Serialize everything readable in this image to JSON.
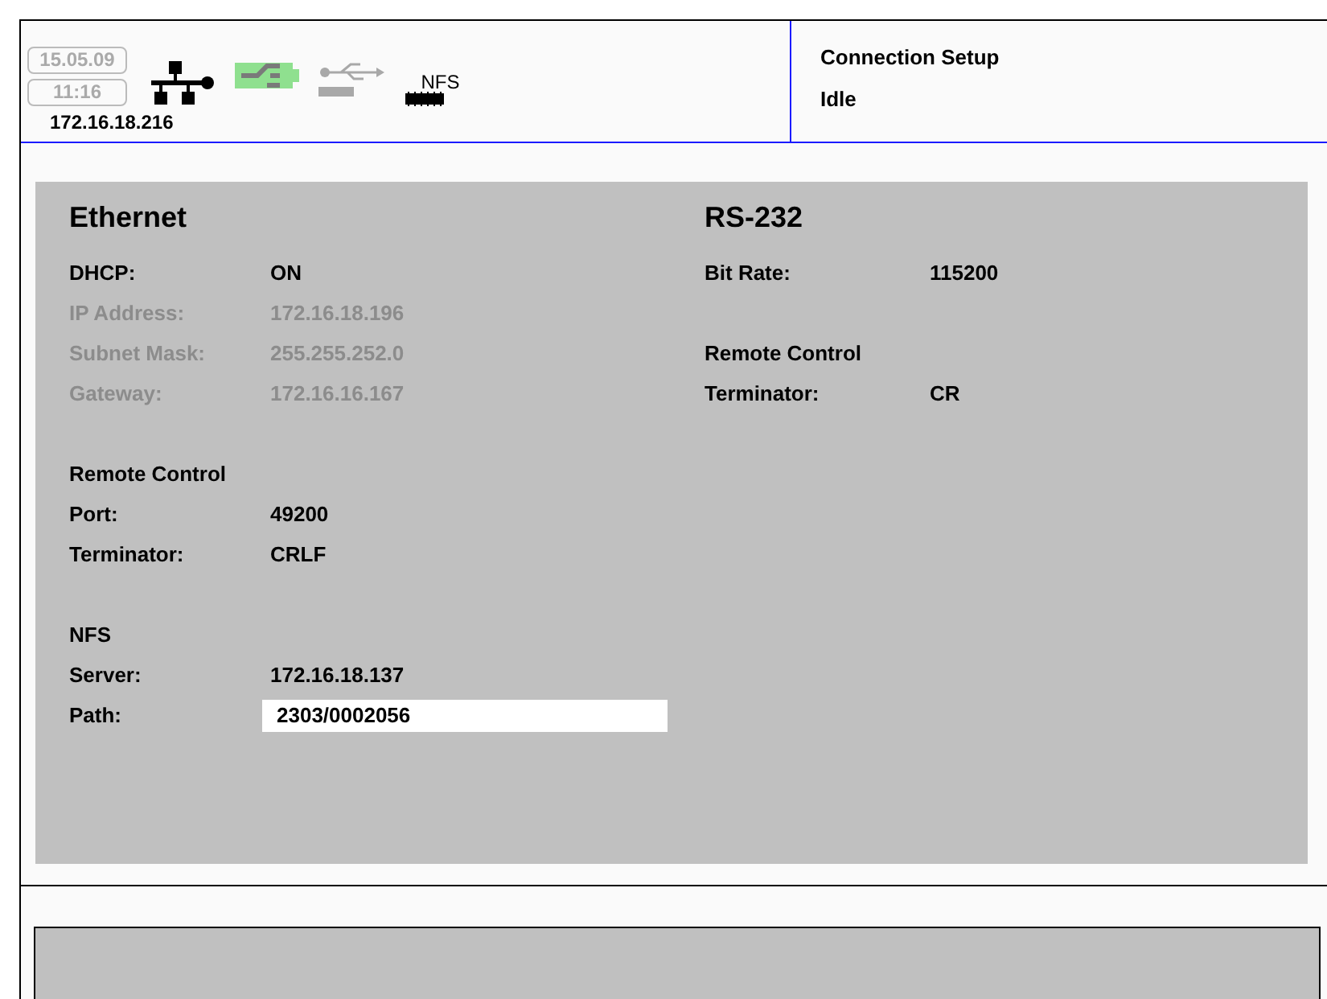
{
  "status": {
    "date": "15.05.09",
    "time": "11:16",
    "ip": "172.16.18.216",
    "nfs_label": "NFS"
  },
  "header": {
    "title": "Connection Setup",
    "state": "Idle"
  },
  "panels": [
    {
      "title": "Ethernet",
      "groups": [
        {
          "rows": [
            {
              "label": "DHCP:",
              "value": "ON",
              "disabled": false,
              "kind": "text"
            },
            {
              "label": "IP Address:",
              "value": "172.16.18.196",
              "disabled": true,
              "kind": "text"
            },
            {
              "label": "Subnet Mask:",
              "value": "255.255.252.0",
              "disabled": true,
              "kind": "text"
            },
            {
              "label": "Gateway:",
              "value": "172.16.16.167",
              "disabled": true,
              "kind": "text"
            }
          ]
        },
        {
          "heading": "Remote Control",
          "rows": [
            {
              "label": "Port:",
              "value": "49200",
              "disabled": false,
              "kind": "text"
            },
            {
              "label": "Terminator:",
              "value": "CRLF",
              "disabled": false,
              "kind": "text"
            }
          ]
        },
        {
          "heading": "NFS",
          "rows": [
            {
              "label": "Server:",
              "value": "172.16.18.137",
              "disabled": false,
              "kind": "text"
            },
            {
              "label": "Path:",
              "value": "2303/0002056",
              "disabled": false,
              "kind": "input"
            }
          ]
        }
      ]
    },
    {
      "title": "RS-232",
      "groups": [
        {
          "rows": [
            {
              "label": "Bit Rate:",
              "value": "115200",
              "disabled": false,
              "kind": "text"
            }
          ]
        },
        {
          "heading": "Remote Control",
          "rows": [
            {
              "label": "Terminator:",
              "value": "CR",
              "disabled": false,
              "kind": "text"
            }
          ]
        }
      ]
    }
  ]
}
